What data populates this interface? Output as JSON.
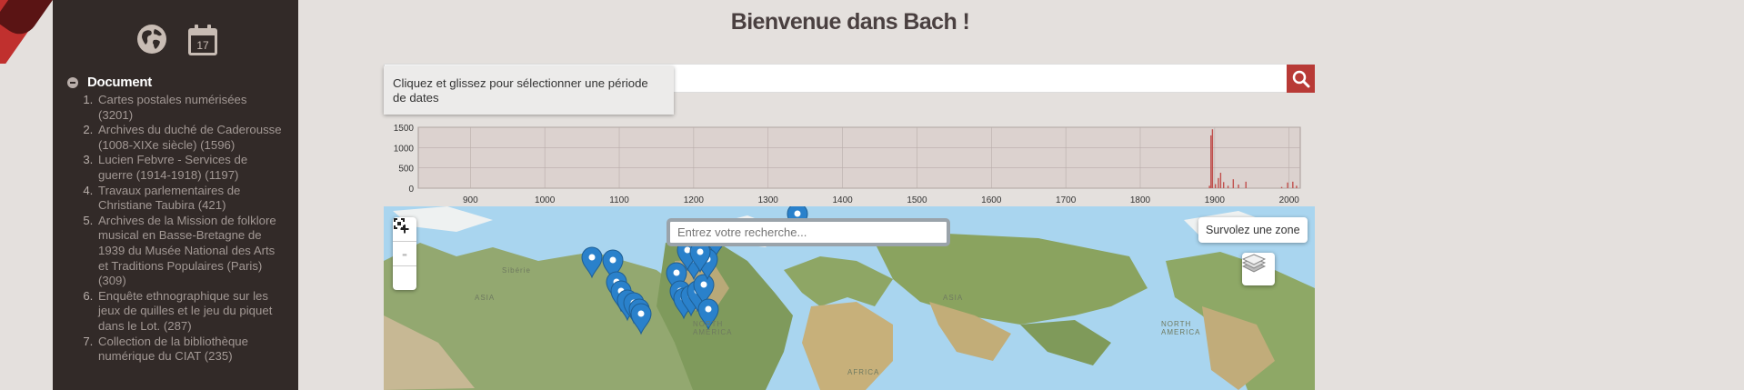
{
  "sidebar": {
    "icons": [
      "globe-icon",
      "calendar-icon"
    ],
    "calendar_day": "17",
    "section_title": "Document",
    "items": [
      "Cartes postales numérisées (3201)",
      "Archives du duché de Caderousse (1008-XIXe siècle) (1596)",
      "Lucien Febvre - Services de guerre (1914-1918) (1197)",
      "Travaux parlementaires de Christiane Taubira (421)",
      "Archives de la Mission de folklore musical en Basse-Bretagne de 1939 du Musée National des Arts et Traditions Populaires (Paris) (309)",
      "Enquête ethnographique sur les jeux de quilles et le jeu du piquet dans le Lot. (287)",
      "Collection de la bibliothèque numérique du CIAT (235)"
    ]
  },
  "header": {
    "title": "Bienvenue dans Bach !"
  },
  "search": {
    "value": "",
    "tooltip": "Cliquez et glissez pour sélectionner une période de dates"
  },
  "chart_data": {
    "type": "bar",
    "xlabel": "",
    "ylabel": "",
    "xlim": [
      830,
      2015
    ],
    "ylim": [
      0,
      1500
    ],
    "yticks": [
      "0",
      "500",
      "1000",
      "1500"
    ],
    "xticks": [
      "900",
      "1000",
      "1100",
      "1200",
      "1300",
      "1400",
      "1500",
      "1600",
      "1700",
      "1800",
      "1900",
      "2000"
    ],
    "grid": true,
    "x": [
      1893,
      1895,
      1897,
      1901,
      1905,
      1908,
      1912,
      1918,
      1925,
      1932,
      1942,
      1990,
      1998,
      2005,
      2010
    ],
    "values": [
      60,
      1300,
      1450,
      100,
      250,
      380,
      150,
      60,
      220,
      90,
      160,
      30,
      140,
      160,
      60
    ],
    "bar_color": "#c0504d"
  },
  "map": {
    "zoom_in": "+",
    "zoom_out": "-",
    "search_placeholder": "Entrez votre recherche...",
    "hover_label": "Survolez une zone",
    "labels": [
      "Sibérie",
      "ASIA",
      "ASIA",
      "NORTH AMERICA",
      "NORTH AMERICA",
      "AFRICA"
    ],
    "marker_color": "#2a81cb"
  }
}
